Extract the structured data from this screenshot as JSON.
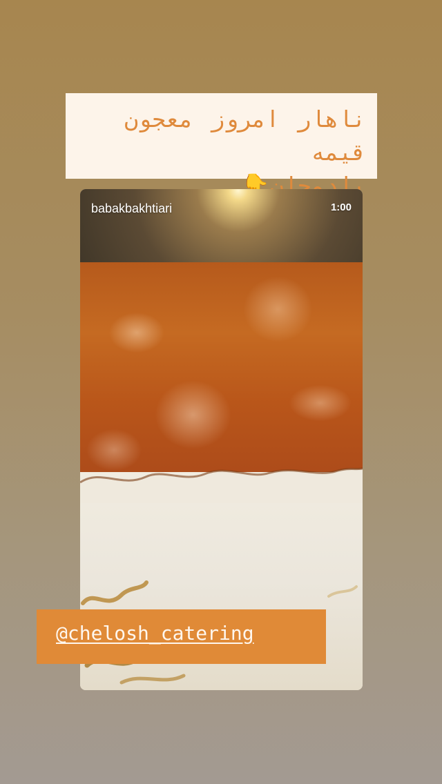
{
  "caption": {
    "line1": "ناهار امروز معجون قیمه",
    "line2": "بادمجان",
    "emoji": "👇"
  },
  "story_card": {
    "username": "babakbakhtiari",
    "duration": "1:00"
  },
  "mention_sticker": {
    "label": "@chelosh_catering"
  },
  "colors": {
    "caption_text": "#df8a3c",
    "caption_bg": "#fdf4ea",
    "mention_bg": "#e08a37"
  }
}
